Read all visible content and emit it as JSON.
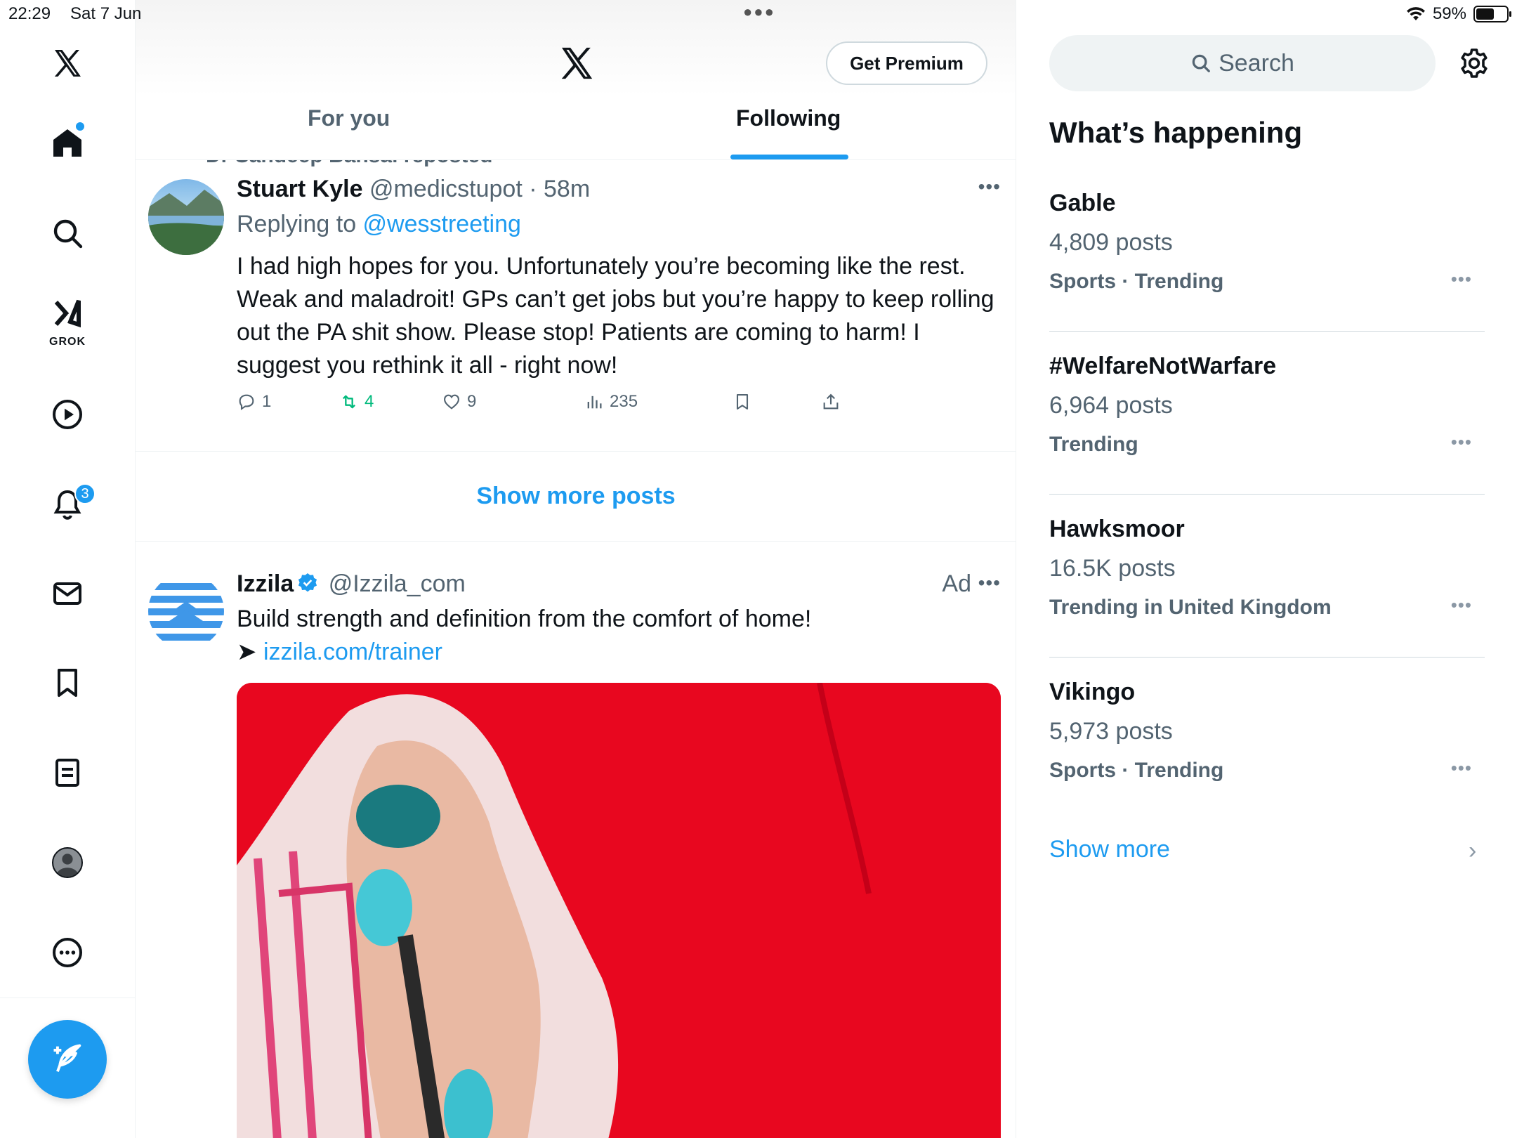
{
  "status": {
    "time": "22:29",
    "date": "Sat 7 Jun",
    "battery": "59%",
    "battery_level": 0.59
  },
  "nav": {
    "grok_label": "GROK",
    "notifications_badge": "3"
  },
  "header": {
    "premium_label": "Get Premium",
    "tabs": [
      {
        "label": "For you",
        "active": false
      },
      {
        "label": "Following",
        "active": true
      }
    ]
  },
  "feed": {
    "repost_note": "Dr Sandeep Bansal reposted",
    "post1": {
      "name": "Stuart Kyle",
      "handle": "@medicstupot",
      "time": "· 58m",
      "replying_prefix": "Replying to ",
      "replying_to": "@wesstreeting",
      "text": "I had high hopes for you. Unfortunately you’re becoming like the rest. Weak and maladroit! GPs can’t get jobs but you’re happy to keep rolling out the PA shit show. Please stop! Patients are coming to harm! I suggest you rethink it all - right now!",
      "replies": "1",
      "reposts": "4",
      "likes": "9",
      "views": "235"
    },
    "show_more_posts": "Show more posts",
    "ad": {
      "name": "Izzila",
      "handle": "@Izzila_com",
      "ad_label": "Ad",
      "text": "Build strength and definition from the comfort of home!",
      "arrow": "➤ ",
      "link": "izzila.com/trainer"
    }
  },
  "sidebar": {
    "search_placeholder": "Search",
    "title": "What’s happening",
    "trends": [
      {
        "name": "Gable",
        "count": "4,809 posts",
        "meta": "Sports · Trending"
      },
      {
        "name": "#WelfareNotWarfare",
        "count": "6,964 posts",
        "meta": "Trending"
      },
      {
        "name": "Hawksmoor",
        "count": "16.5K posts",
        "meta": "Trending in United Kingdom"
      },
      {
        "name": "Vikingo",
        "count": "5,973 posts",
        "meta": "Sports · Trending"
      }
    ],
    "show_more": "Show more"
  },
  "colors": {
    "accent": "#1d9bf0",
    "text_secondary": "#536471",
    "repost_green": "#00ba7c",
    "ad_media_red": "#e8071f"
  },
  "icons": [
    "x-logo-icon",
    "home-icon",
    "search-icon",
    "grok-icon",
    "video-icon",
    "bell-icon",
    "mail-icon",
    "bookmark-icon",
    "lists-icon",
    "profile-icon",
    "more-icon",
    "compose-icon",
    "gear-icon",
    "reply-icon",
    "repost-icon",
    "like-icon",
    "views-icon",
    "share-icon",
    "verified-icon",
    "chevron-right-icon"
  ]
}
